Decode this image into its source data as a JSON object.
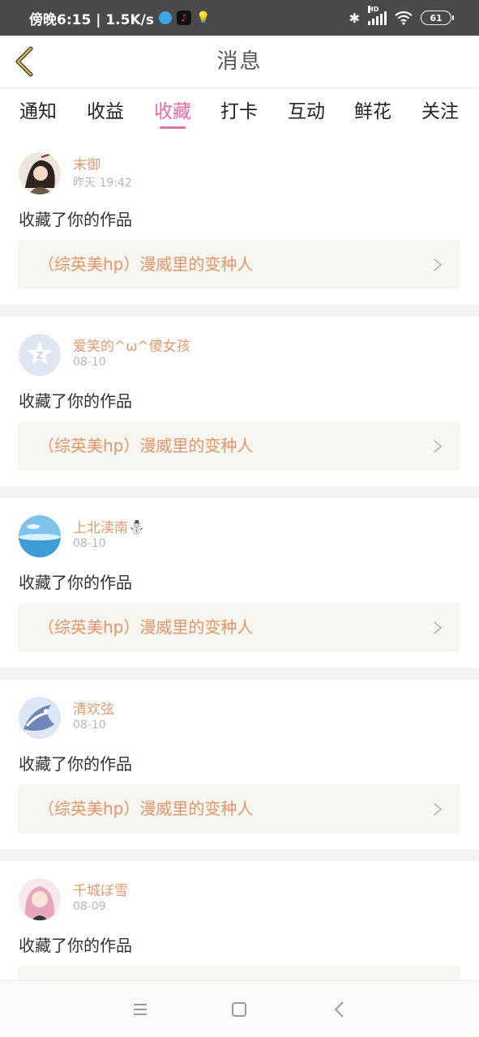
{
  "status_bar": {
    "time_speed": "傍晚6:15 | 1.5K/s",
    "battery": "61",
    "hd": "HD"
  },
  "header": {
    "title": "消息"
  },
  "tabs": [
    {
      "label": "通知",
      "active": false
    },
    {
      "label": "收益",
      "active": false
    },
    {
      "label": "收藏",
      "active": true
    },
    {
      "label": "打卡",
      "active": false
    },
    {
      "label": "互动",
      "active": false
    },
    {
      "label": "鲜花",
      "active": false
    },
    {
      "label": "关注",
      "active": false
    }
  ],
  "messages": [
    {
      "username": "末御",
      "time": "昨天 19:42",
      "action": "收藏了你的作品",
      "work": "（综英美hp）漫威里的变种人"
    },
    {
      "username": "爱笑的^ω^傻女孩",
      "time": "08-10",
      "action": "收藏了你的作品",
      "work": "（综英美hp）漫威里的变种人"
    },
    {
      "username": "上北渎南⛄",
      "time": "08-10",
      "action": "收藏了你的作品",
      "work": "（综英美hp）漫威里的变种人"
    },
    {
      "username": "清欢弦",
      "time": "08-10",
      "action": "收藏了你的作品",
      "work": "（综英美hp）漫威里的变种人"
    },
    {
      "username": "千城ぼ雪",
      "time": "08-09",
      "action": "收藏了你的作品",
      "work": ""
    }
  ],
  "colors": {
    "accent": "#e86aa6",
    "username": "#e09a6e",
    "work_title": "#e3956a",
    "back_icon": "#d8b84a"
  }
}
